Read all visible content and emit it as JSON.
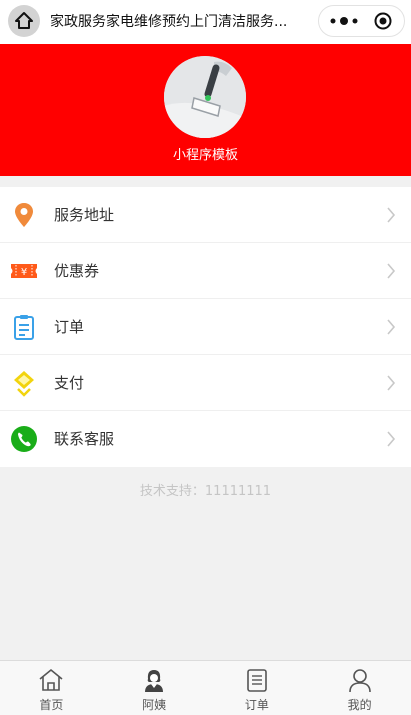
{
  "navbar": {
    "title": "家政服务家电维修预约上门清洁服务...",
    "home_icon": "home-icon",
    "more_icon": "more-dots-icon",
    "close_icon": "target-close-icon"
  },
  "header": {
    "background": "#ff0000",
    "shop_name": "小程序模板"
  },
  "menu": {
    "items": [
      {
        "label": "服务地址",
        "icon": "location-pin-icon",
        "color": "#f08a3b"
      },
      {
        "label": "优惠券",
        "icon": "coupon-icon",
        "color": "#ff5a1a"
      },
      {
        "label": "订单",
        "icon": "clipboard-icon",
        "color": "#3aa1e8"
      },
      {
        "label": "支付",
        "icon": "payment-icon",
        "color": "#f2d40e"
      },
      {
        "label": "联系客服",
        "icon": "phone-icon",
        "color": "#1aad19"
      }
    ]
  },
  "support_text": "技术支持：11111111",
  "tabbar": {
    "tabs": [
      {
        "label": "首页",
        "icon": "home-outline-icon"
      },
      {
        "label": "阿姨",
        "icon": "nanny-icon"
      },
      {
        "label": "订单",
        "icon": "order-list-icon"
      },
      {
        "label": "我的",
        "icon": "user-profile-icon"
      }
    ]
  }
}
